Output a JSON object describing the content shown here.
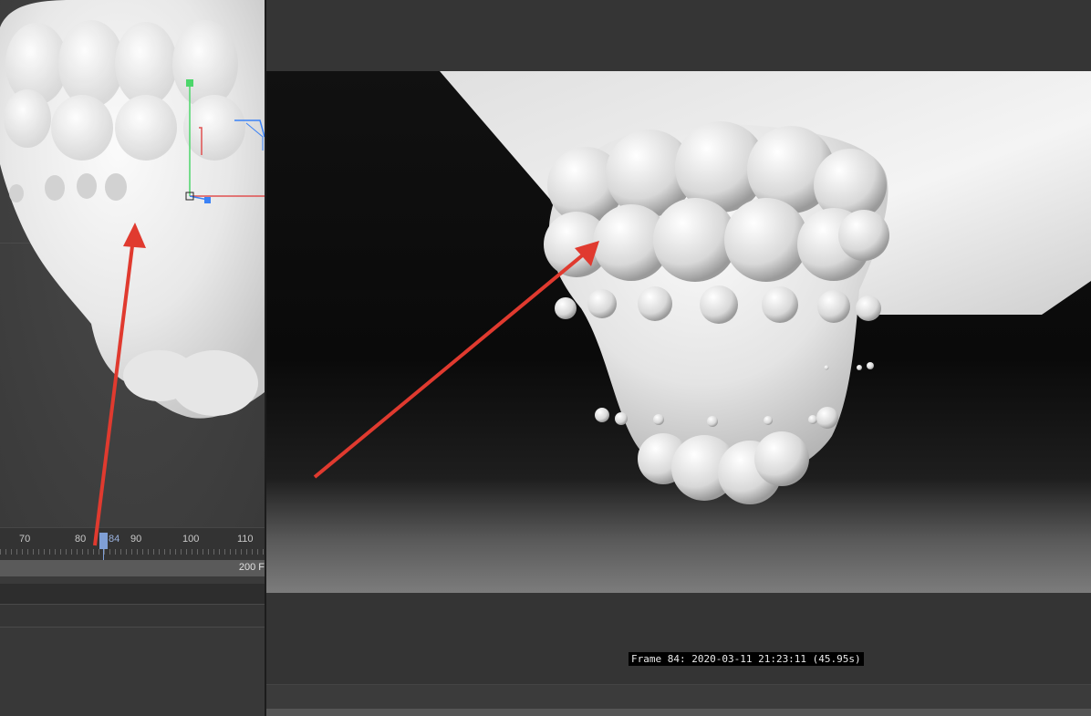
{
  "timeline": {
    "ticks": [
      "70",
      "80",
      "90",
      "100",
      "110"
    ],
    "current_frame": "84",
    "range_end": "200 F"
  },
  "render": {
    "frame_info": "Frame 84: 2020-03-11 21:23:11 (45.95s)"
  },
  "colors": {
    "annotation_arrow": "#e03a2f",
    "playhead": "#7f9fd6",
    "axis_y": "#4cd66a",
    "axis_x": "#e05050",
    "axis_z": "#3b82f6"
  },
  "icons": {
    "gizmo": "move-gizmo-icon",
    "arrow": "annotation-arrow-icon"
  }
}
